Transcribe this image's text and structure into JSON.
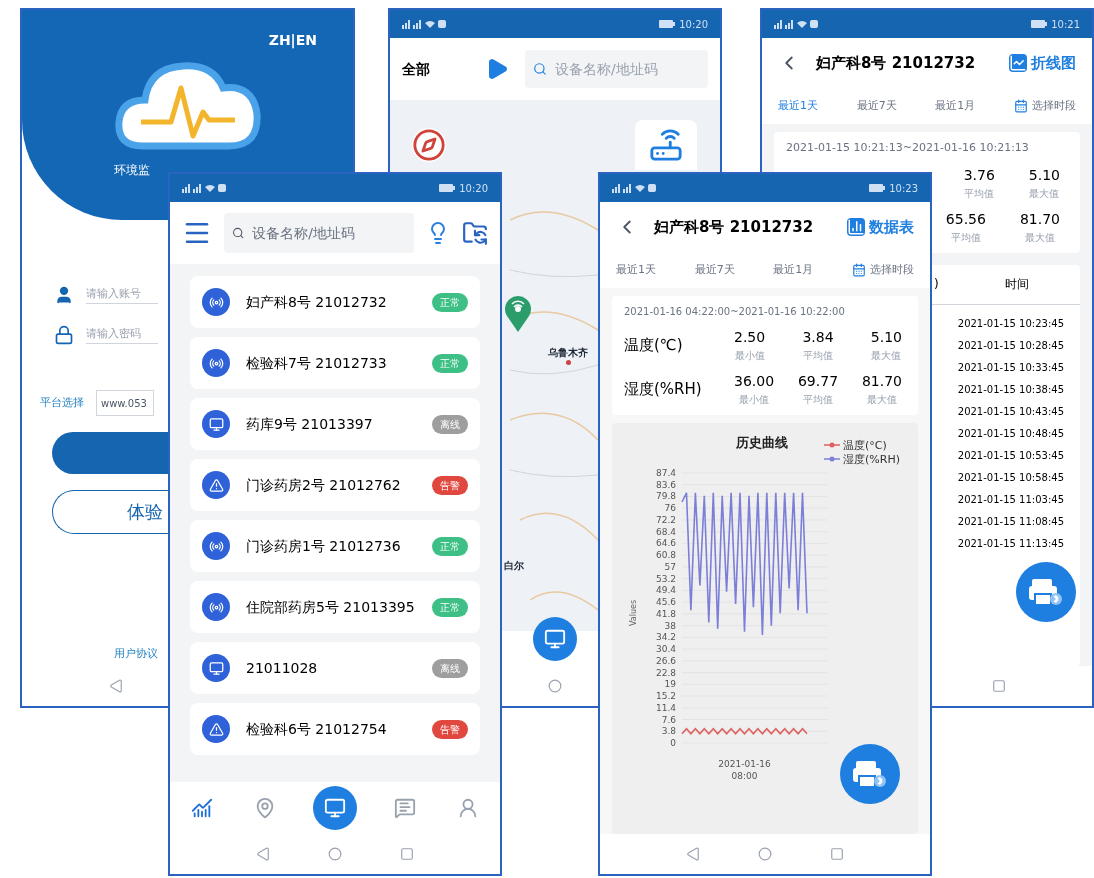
{
  "login_screen": {
    "language_switch": "ZH|EN",
    "app_name": "环境监",
    "account_field": {
      "placeholder": "请输入账号"
    },
    "password_field": {
      "placeholder": "请输入密码"
    },
    "platform_select": {
      "label": "平台选择",
      "value": "www.053"
    },
    "trial_button": "体验",
    "user_agreement_link": "用户协议"
  },
  "map_screen": {
    "status_time": "10:20",
    "filter": "全部",
    "search": {
      "placeholder": "设备名称/地址码"
    },
    "map_labels": [
      {
        "text": "乌鲁木齐",
        "kind": "city"
      },
      {
        "text": "白尔",
        "kind": "place"
      }
    ]
  },
  "table_screen": {
    "status_time": "10:21",
    "title": "妇产科8号 21012732",
    "view_switch": "折线图",
    "ranges": [
      {
        "label": "最近1天",
        "selected": true
      },
      {
        "label": "最近7天",
        "selected": false
      },
      {
        "label": "最近1月",
        "selected": false
      }
    ],
    "custom_range": "选择时段",
    "date_range": "2021-01-15 10:21:13~2021-01-16 10:21:13",
    "stats": [
      {
        "values": [
          {
            "value": "3.76",
            "label": "平均值"
          },
          {
            "value": "5.10",
            "label": "最大值"
          }
        ]
      },
      {
        "values": [
          {
            "value": "65.56",
            "label": "平均值"
          },
          {
            "value": "81.70",
            "label": "最大值"
          }
        ]
      }
    ],
    "table": {
      "columns": [
        ")",
        "时间"
      ],
      "rows": [
        "2021-01-15 10:23:45",
        "2021-01-15 10:28:45",
        "2021-01-15 10:33:45",
        "2021-01-15 10:38:45",
        "2021-01-15 10:43:45",
        "2021-01-15 10:48:45",
        "2021-01-15 10:53:45",
        "2021-01-15 10:58:45",
        "2021-01-15 11:03:45",
        "2021-01-15 11:08:45",
        "2021-01-15 11:13:45"
      ]
    }
  },
  "device_list_screen": {
    "status_time": "10:20",
    "search": {
      "placeholder": "设备名称/地址码"
    },
    "devices": [
      {
        "name": "妇产科8号 21012732",
        "kind": "online",
        "status": "正常",
        "color": "#3dbf85"
      },
      {
        "name": "检验科7号 21012733",
        "kind": "online",
        "status": "正常",
        "color": "#3dbf85"
      },
      {
        "name": "药库9号 21013397",
        "kind": "offline",
        "status": "离线",
        "color": "#9e9e9e"
      },
      {
        "name": "门诊药房2号 21012762",
        "kind": "alarm",
        "status": "告警",
        "color": "#e0473f"
      },
      {
        "name": "门诊药房1号 21012736",
        "kind": "online",
        "status": "正常",
        "color": "#3dbf85"
      },
      {
        "name": "住院部药房5号 21013395",
        "kind": "online",
        "status": "正常",
        "color": "#3dbf85"
      },
      {
        "name": "21011028",
        "kind": "offline",
        "status": "离线",
        "color": "#9e9e9e"
      },
      {
        "name": "检验科6号 21012754",
        "kind": "alarm",
        "status": "告警",
        "color": "#e0473f"
      }
    ],
    "bottom_nav": [
      {
        "kind": "chart",
        "selected": true
      },
      {
        "kind": "location",
        "selected": false
      },
      {
        "kind": "center",
        "selected": false
      },
      {
        "kind": "message",
        "selected": false
      },
      {
        "kind": "profile",
        "selected": false
      }
    ]
  },
  "chart_screen": {
    "status_time": "10:23",
    "title": "妇产科8号 21012732",
    "view_switch": "数据表",
    "ranges": [
      {
        "label": "最近1天",
        "selected": false
      },
      {
        "label": "最近7天",
        "selected": false
      },
      {
        "label": "最近1月",
        "selected": false
      }
    ],
    "custom_range": "选择时段",
    "date_range": "2021-01-16 04:22:00~2021-01-16 10:22:00",
    "stats": [
      {
        "name": "温度(℃)",
        "values": [
          {
            "value": "2.50",
            "label": "最小值"
          },
          {
            "value": "3.84",
            "label": "平均值"
          },
          {
            "value": "5.10",
            "label": "最大值"
          }
        ]
      },
      {
        "name": "湿度(%RH)",
        "values": [
          {
            "value": "36.00",
            "label": "最小值"
          },
          {
            "value": "69.77",
            "label": "平均值"
          },
          {
            "value": "81.70",
            "label": "最大值"
          }
        ]
      }
    ],
    "chart_data": {
      "type": "line",
      "title": "历史曲线",
      "ylabel": "Values",
      "grid": true,
      "legend": true,
      "series": [
        {
          "name": "温度(°C)",
          "color": "#e06060",
          "values": [
            3,
            4.6,
            3,
            4.6,
            3,
            4.6,
            3,
            4.6,
            3,
            4.6,
            3,
            4.6,
            3,
            4.6,
            3,
            4.6,
            3,
            4.6,
            3,
            4.6,
            3,
            4.6,
            3,
            4.6,
            3,
            4.6,
            3,
            4.6,
            3
          ]
        },
        {
          "name": "湿度(%RH)",
          "color": "#7c7fd8",
          "values": [
            78,
            81,
            43,
            81,
            51,
            80,
            39,
            81,
            37,
            80,
            49,
            81,
            45,
            81,
            36,
            80,
            44,
            81,
            35,
            81,
            38,
            81,
            42,
            81,
            50,
            81,
            43,
            81,
            42
          ]
        }
      ],
      "ylim": [
        0,
        87.4
      ],
      "yticks": [
        0,
        3.8,
        7.6,
        11.4,
        15.2,
        19,
        22.8,
        26.6,
        30.4,
        34.2,
        38,
        41.8,
        45.6,
        49.4,
        53.2,
        57,
        60.8,
        64.6,
        68.4,
        72.2,
        76,
        79.8,
        83.6,
        87.4
      ],
      "xlabel": "2021-01-16 08:00"
    }
  }
}
